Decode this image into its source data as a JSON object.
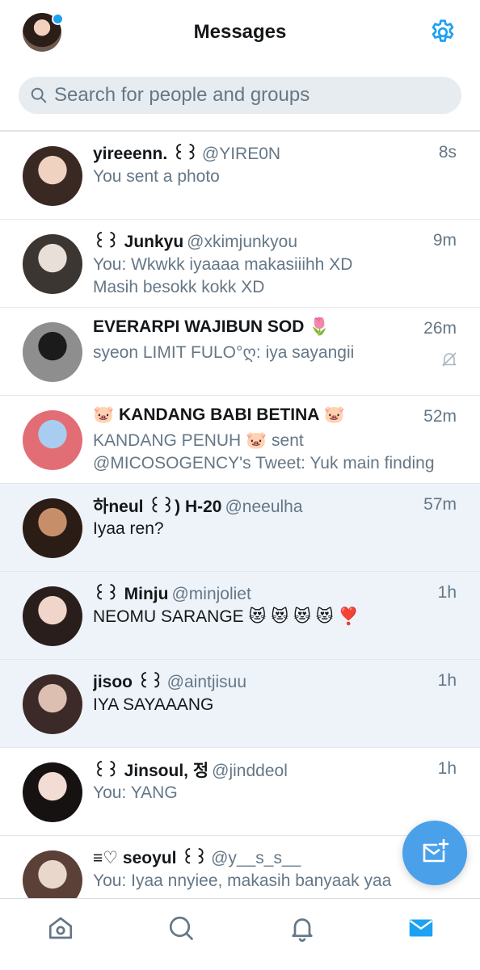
{
  "header": {
    "title": "Messages",
    "notification_dot": true
  },
  "search": {
    "placeholder": "Search for people and groups"
  },
  "conversations": [
    {
      "name": "yireeenn. ꒰꒱",
      "handle": "@YIRE0N",
      "time": "8s",
      "preview": [
        "You sent a photo"
      ],
      "unread": false,
      "avatar_colors": [
        "#efd2c0",
        "#3a2922"
      ]
    },
    {
      "name": "꒰꒱ Junkyu",
      "handle": "@xkimjunkyou",
      "time": "9m",
      "preview": [
        "You: Wkwkk iyaaaa makasiiihh XD",
        "Masih besokk kokk XD"
      ],
      "unread": false,
      "avatar_colors": [
        "#e8dfd8",
        "#3b3631"
      ]
    },
    {
      "name": "EVERARPI WAJIBUN SOD 🌷",
      "handle": "",
      "time": "26m",
      "preview": [
        "syeon LIMIT FULO°ღ: iya sayangii"
      ],
      "unread": false,
      "muted": true,
      "avatar_colors": [
        "#1b1b1b",
        "#8e8e8e"
      ]
    },
    {
      "name": "🐷 KANDANG BABI BETINA 🐷",
      "handle": "",
      "time": "52m",
      "preview": [
        "KANDANG PENUH 🐷 sent",
        "@MICOSOGENCY's Tweet: Yuk main finding"
      ],
      "unread": false,
      "avatar_colors": [
        "#a9cdf1",
        "#e36d75"
      ]
    },
    {
      "name": "하neul ꒰꒱) H-20",
      "handle": "@neeulha",
      "time": "57m",
      "preview": [
        "Iyaa ren?"
      ],
      "unread": true,
      "avatar_colors": [
        "#c78f69",
        "#2c1c16"
      ]
    },
    {
      "name": "꒰꒱ Minju",
      "handle": "@minjoliet",
      "time": "1h",
      "preview": [
        "NEOMU SARANGE 😻 😻 😻 😻 ❣️"
      ],
      "unread": true,
      "avatar_colors": [
        "#f0d6ca",
        "#2a1e1c"
      ]
    },
    {
      "name": "jisoo ꒰꒱",
      "handle": "@aintjisuu",
      "time": "1h",
      "preview": [
        "IYA SAYAAANG"
      ],
      "unread": true,
      "avatar_colors": [
        "#dcbfb1",
        "#3b2a27"
      ]
    },
    {
      "name": "꒰꒱ Jinsoul, 정",
      "handle": "@jinddeol",
      "time": "1h",
      "preview": [
        "You: YANG"
      ],
      "unread": false,
      "avatar_colors": [
        "#f2dcd3",
        "#161212"
      ]
    },
    {
      "name": "≡♡ seoyul ꒰꒱",
      "handle": "@y__s_s__",
      "time": "",
      "preview": [
        "You: Iyaa nnyiee, makasih banyaak yaa"
      ],
      "unread": false,
      "avatar_colors": [
        "#ead7cc",
        "#5a4036"
      ]
    }
  ],
  "bottom_nav": {
    "tabs": [
      {
        "icon": "home-icon",
        "active": false
      },
      {
        "icon": "search-icon",
        "active": false
      },
      {
        "icon": "bell-icon",
        "active": false
      },
      {
        "icon": "mail-icon",
        "active": true
      }
    ]
  },
  "fab": {
    "icon": "new-message-icon"
  },
  "colors": {
    "accent": "#1da1f2",
    "fab": "#4aa1ea",
    "unread_bg": "#eef3fa",
    "muted_text": "#657786"
  }
}
